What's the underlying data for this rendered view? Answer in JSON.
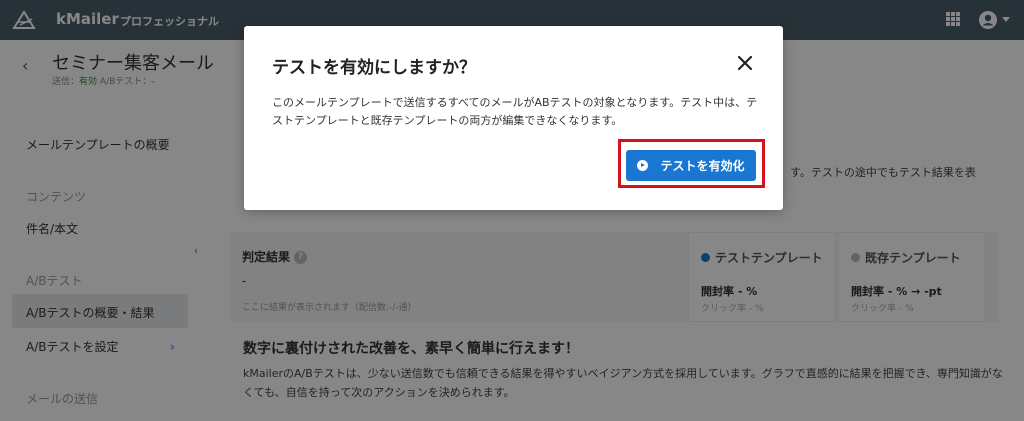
{
  "header": {
    "brand": "kMailer",
    "plan": "プロフェッショナル",
    "icons": [
      "logo-icon",
      "apps-grid-icon",
      "account-icon",
      "caret-down-icon"
    ]
  },
  "page": {
    "title": "セミナー集客メール",
    "status_prefix": "送信：",
    "status_value": "有効",
    "status_suffix": " A/Bテスト：-",
    "bg_hint": "す。テストの途中でもテスト結果を表"
  },
  "sidebar": {
    "items": [
      {
        "label": "メールテンプレートの概要",
        "type": "item"
      },
      {
        "label": "コンテンツ",
        "type": "group"
      },
      {
        "label": "件名/本文",
        "type": "item"
      },
      {
        "label": "A/Bテスト",
        "type": "group"
      },
      {
        "label": "A/Bテストの概要・結果",
        "type": "item",
        "active": true
      },
      {
        "label": "A/Bテストを設定",
        "type": "item"
      },
      {
        "label": "メールの送信",
        "type": "group"
      }
    ]
  },
  "result_card": {
    "label": "判定結果",
    "value": "-",
    "note": "ここに結果が表示されます（配信数:-/-通）",
    "test_template": {
      "name": "テストテンプレート",
      "rate": "開封率 ‐ %",
      "click": "クリック率 - %",
      "color": "#1976d2"
    },
    "existing_template": {
      "name": "既存テンプレート",
      "rate": "開封率 ‐ % → -pt",
      "click": "クリック率 - %",
      "color": "#bbbbbb"
    }
  },
  "lead": {
    "title": "数字に裏付けされた改善を、素早く簡単に行えます！",
    "body": "kMailerのA/Bテストは、少ない送信数でも信頼できる結果を得やすいベイジアン方式を採用しています。グラフで直感的に結果を把握でき、専門知識がなくても、自信を持って次のアクションを決められます。"
  },
  "modal": {
    "title": "テストを有効にしますか？",
    "body": "このメールテンプレートで送信するすべてのメールがABテストの対象となります。テスト中は、テストテンプレートと既存テンプレートの両方が編集できなくなります。",
    "confirm_label": "テストを有効化",
    "highlight_color": "#d6101c",
    "button_color": "#1976d2"
  }
}
